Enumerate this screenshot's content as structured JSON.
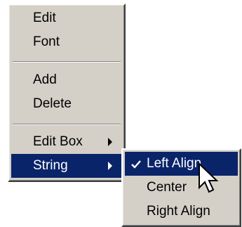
{
  "main_menu": {
    "items": [
      {
        "label": "Edit"
      },
      {
        "label": "Font"
      },
      {
        "label": "Add"
      },
      {
        "label": "Delete"
      },
      {
        "label": "Edit Box"
      },
      {
        "label": "String"
      }
    ]
  },
  "sub_menu": {
    "items": [
      {
        "label": "Left Align",
        "checked": true
      },
      {
        "label": "Center"
      },
      {
        "label": "Right Align"
      }
    ]
  },
  "icons": {
    "check": "check-icon",
    "submenu_arrow": "chevron-right-icon",
    "pointer": "mouse-pointer-icon"
  },
  "colors": {
    "menu_face": "#d4d0c8",
    "highlight": "#0a246a",
    "highlight_text": "#ffffff"
  }
}
